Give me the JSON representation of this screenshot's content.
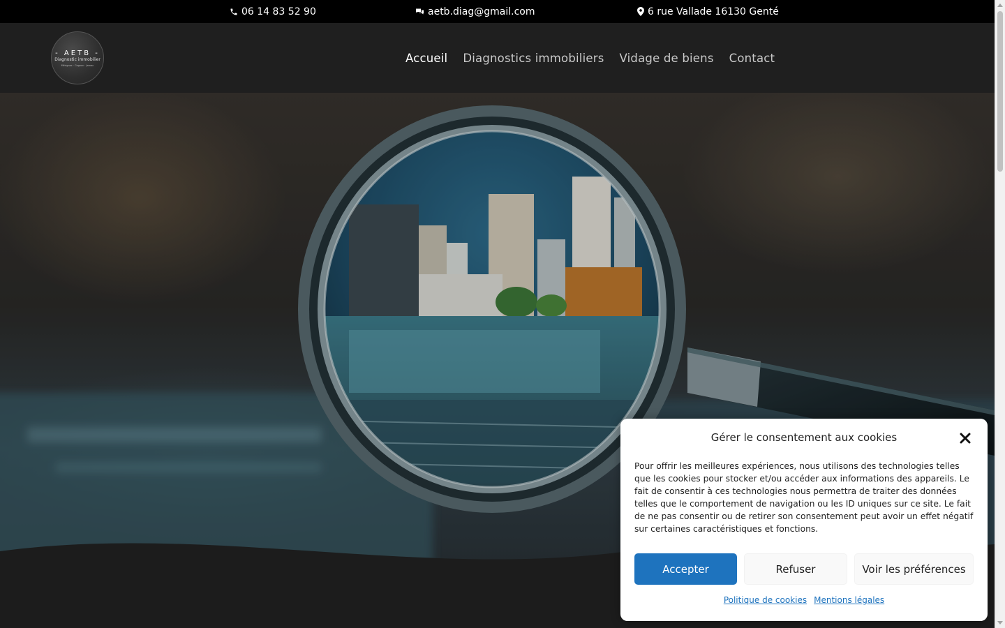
{
  "topbar": {
    "phone": "06 14 83 52 90",
    "email": "aetb.diag@gmail.com",
    "address": "6 rue Vallade 16130 Genté",
    "icons": [
      "phone-icon",
      "chat-icon",
      "location-pin-icon"
    ]
  },
  "logo": {
    "line1": "- AETB -",
    "line2": "Diagnostic immobilier",
    "line3": "Mérignac · Cognac · Jarnac"
  },
  "nav": {
    "items": [
      {
        "label": "Accueil",
        "active": true
      },
      {
        "label": "Diagnostics immobiliers",
        "active": false
      },
      {
        "label": "Vidage de biens",
        "active": false
      },
      {
        "label": "Contact",
        "active": false
      }
    ]
  },
  "hero": {
    "image_subject": "magnifying-glass-over-city-plans"
  },
  "cookie": {
    "title": "Gérer le consentement aux cookies",
    "text": "Pour offrir les meilleures expériences, nous utilisons des technologies telles que les cookies pour stocker et/ou accéder aux informations des appareils. Le fait de consentir à ces technologies nous permettra de traiter des données telles que le comportement de navigation ou les ID uniques sur ce site. Le fait de ne pas consentir ou de retirer son consentement peut avoir un effet négatif sur certaines caractéristiques et fonctions.",
    "accept": "Accepter",
    "refuse": "Refuser",
    "preferences": "Voir les préférences",
    "link_policy": "Politique de cookies",
    "link_legal": "Mentions légales",
    "accent_color": "#1e73be"
  },
  "colors": {
    "topbar_bg": "#000000",
    "header_bg": "#1f1f1f",
    "page_bg": "#1c1c1c"
  }
}
